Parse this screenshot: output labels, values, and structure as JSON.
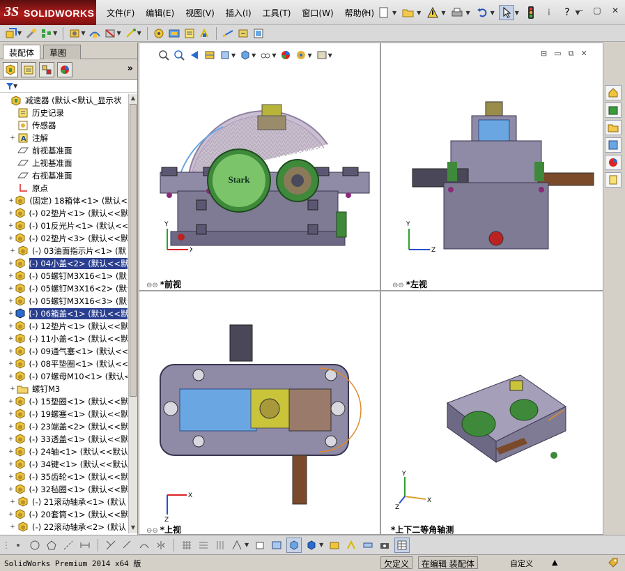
{
  "app": {
    "logo_ds": "3S",
    "logo_sw": "SOLIDWORKS"
  },
  "menu": [
    "文件(F)",
    "编辑(E)",
    "视图(V)",
    "插入(I)",
    "工具(T)",
    "窗口(W)",
    "帮助(H)"
  ],
  "panel": {
    "tabs": [
      "装配体",
      "草图"
    ],
    "more": "»"
  },
  "tree": [
    {
      "label": "减速器  (默认<默认_显示状",
      "icon": "assembly",
      "exp": "",
      "sel": false
    },
    {
      "label": "历史记录",
      "icon": "history",
      "exp": "",
      "sel": false
    },
    {
      "label": "传感器",
      "icon": "sensor",
      "exp": "",
      "sel": false
    },
    {
      "label": "注解",
      "icon": "annotation",
      "exp": "+",
      "sel": false
    },
    {
      "label": "前视基准面",
      "icon": "plane",
      "exp": "",
      "sel": false
    },
    {
      "label": "上视基准面",
      "icon": "plane",
      "exp": "",
      "sel": false
    },
    {
      "label": "右视基准面",
      "icon": "plane",
      "exp": "",
      "sel": false
    },
    {
      "label": "原点",
      "icon": "origin",
      "exp": "",
      "sel": false
    },
    {
      "label": "(固定) 18箱体<1> (默认<",
      "icon": "part",
      "exp": "+",
      "sel": false
    },
    {
      "label": "(-) 02垫片<1> (默认<<默",
      "icon": "part",
      "exp": "+",
      "sel": false
    },
    {
      "label": "(-) 01反光片<1> (默认<<",
      "icon": "part",
      "exp": "+",
      "sel": false
    },
    {
      "label": "(-) 02垫片<3> (默认<<默",
      "icon": "part",
      "exp": "+",
      "sel": false
    },
    {
      "label": "(-) 03油面指示片<1> (默",
      "icon": "part",
      "exp": "+",
      "sel": false
    },
    {
      "label": "(-) 04小盖<2> (默认<<默",
      "icon": "part",
      "exp": "+",
      "sel": true
    },
    {
      "label": "(-) 05螺钉M3X16<1> (默认",
      "icon": "part",
      "exp": "+",
      "sel": false
    },
    {
      "label": "(-) 05螺钉M3X16<2> (默认",
      "icon": "part",
      "exp": "+",
      "sel": false
    },
    {
      "label": "(-) 05螺钉M3X16<3> (默认",
      "icon": "part",
      "exp": "+",
      "sel": false
    },
    {
      "label": "(-) 06箱盖<1> (默认<<默",
      "icon": "partblue",
      "exp": "+",
      "sel": true
    },
    {
      "label": "(-) 12垫片<1> (默认<<默",
      "icon": "part",
      "exp": "+",
      "sel": false
    },
    {
      "label": "(-) 11小盖<1> (默认<<默",
      "icon": "part",
      "exp": "+",
      "sel": false
    },
    {
      "label": "(-) 09通气塞<1> (默认<<",
      "icon": "part",
      "exp": "+",
      "sel": false
    },
    {
      "label": "(-) 08平垫圈<1> (默认<<",
      "icon": "part",
      "exp": "+",
      "sel": false
    },
    {
      "label": "(-) 07螺母M10<1> (默认<<",
      "icon": "part",
      "exp": "+",
      "sel": false
    },
    {
      "label": "螺钉M3",
      "icon": "folder",
      "exp": "+",
      "sel": false
    },
    {
      "label": "(-) 15垫圈<1> (默认<<默",
      "icon": "part",
      "exp": "+",
      "sel": false
    },
    {
      "label": "(-) 19螺塞<1> (默认<<默",
      "icon": "part",
      "exp": "+",
      "sel": false
    },
    {
      "label": "(-) 23端盖<2> (默认<<默",
      "icon": "part",
      "exp": "+",
      "sel": false
    },
    {
      "label": "(-) 33透盖<1> (默认<<默",
      "icon": "part",
      "exp": "+",
      "sel": false
    },
    {
      "label": "(-) 24轴<1> (默认<<默认",
      "icon": "part",
      "exp": "+",
      "sel": false
    },
    {
      "label": "(-) 34键<1> (默认<<默认",
      "icon": "part",
      "exp": "+",
      "sel": false
    },
    {
      "label": "(-) 35齿轮<1> (默认<<默",
      "icon": "part",
      "exp": "+",
      "sel": false
    },
    {
      "label": "(-) 32毡圈<1> (默认<<默",
      "icon": "part",
      "exp": "+",
      "sel": false
    },
    {
      "label": "(-) 21滚动轴承<1> (默认",
      "icon": "part",
      "exp": "+",
      "sel": false
    },
    {
      "label": "(-) 20套筒<1> (默认<<默",
      "icon": "part",
      "exp": "+",
      "sel": false
    },
    {
      "label": "(-) 22滚动轴承<2> (默认",
      "icon": "part",
      "exp": "+",
      "sel": false
    }
  ],
  "views": {
    "front": "*前视",
    "left": "*左视",
    "top": "*上视",
    "iso": "*上下二等角轴测"
  },
  "model": {
    "brand": "Stark"
  },
  "axes": {
    "x": "X",
    "y": "Y",
    "z": "Z"
  },
  "status": {
    "version": "SolidWorks Premium 2014 x64 版",
    "undefined": "欠定义",
    "editing": "在编辑 装配体",
    "custom": "自定义"
  },
  "colors": {
    "selection": "#2a3f8f",
    "housing": "#7f7b94",
    "gear_green": "#5fae4a",
    "accent_red": "#b11b1b"
  }
}
